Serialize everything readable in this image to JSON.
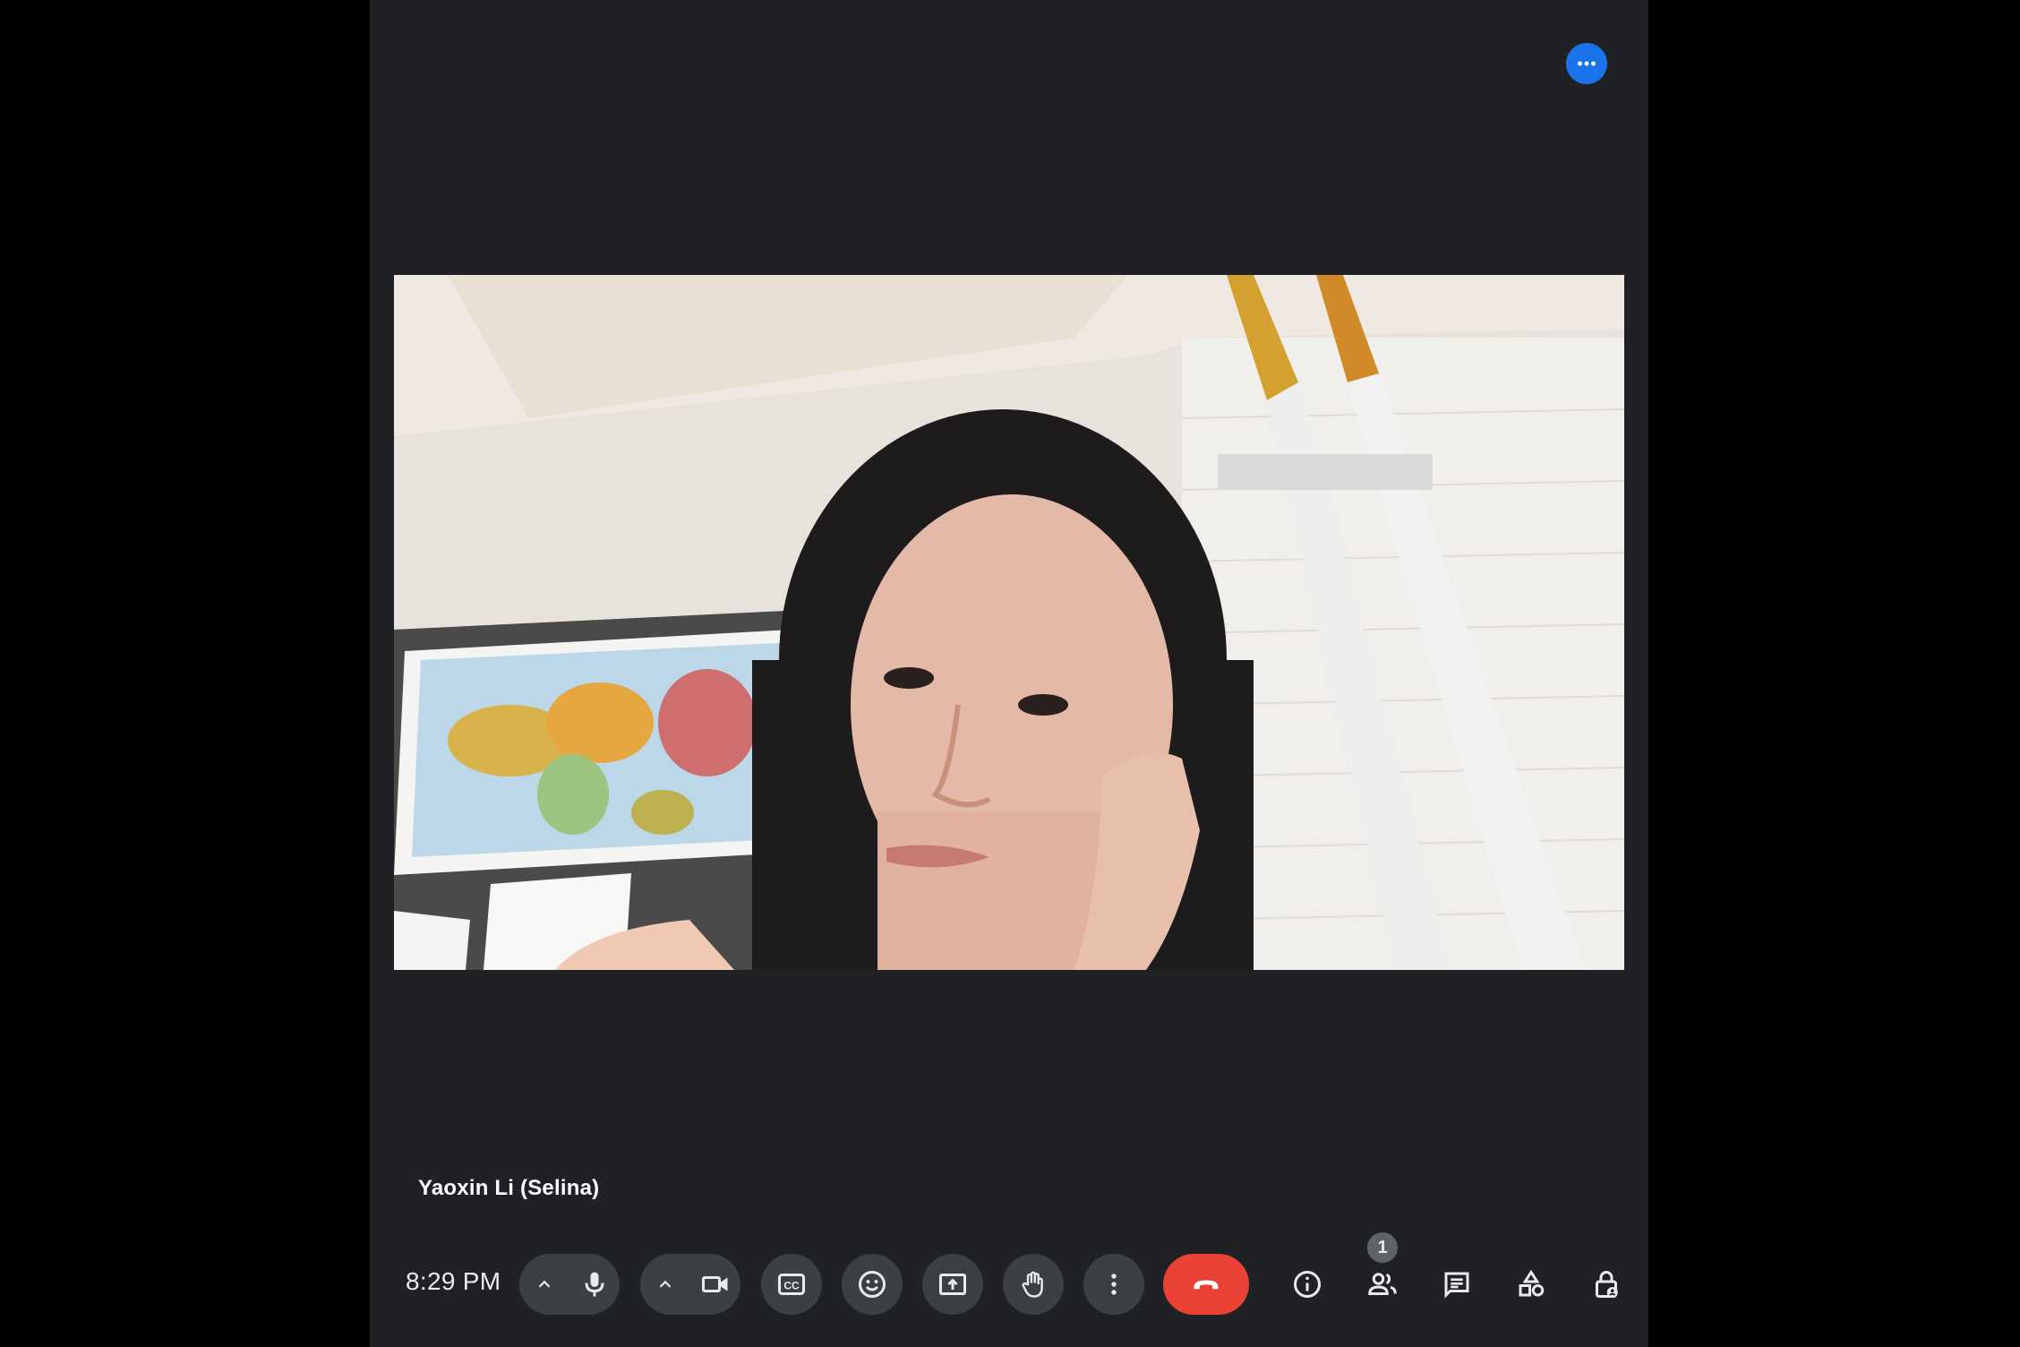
{
  "meeting": {
    "participant_name": "Yaoxin Li (Selina)",
    "clock": "8:29 PM",
    "people_count": "1"
  },
  "icons": {
    "options": "more-horizontal-icon",
    "audio_options": "chevron-up-icon",
    "mic": "microphone-icon",
    "video_options": "chevron-up-icon",
    "camera": "videocam-icon",
    "captions": "closed-captions-icon",
    "reactions": "emoji-icon",
    "present": "present-screen-icon",
    "raise_hand": "hand-icon",
    "more": "more-vertical-icon",
    "end_call": "phone-hangup-icon",
    "info": "info-icon",
    "people": "people-icon",
    "chat": "chat-icon",
    "activities": "shapes-icon",
    "host_controls": "lock-person-icon"
  },
  "colors": {
    "background": "#202124",
    "button": "#3c4043",
    "end_call": "#ea4335",
    "accent": "#1a73e8",
    "icon": "#e8eaed"
  }
}
